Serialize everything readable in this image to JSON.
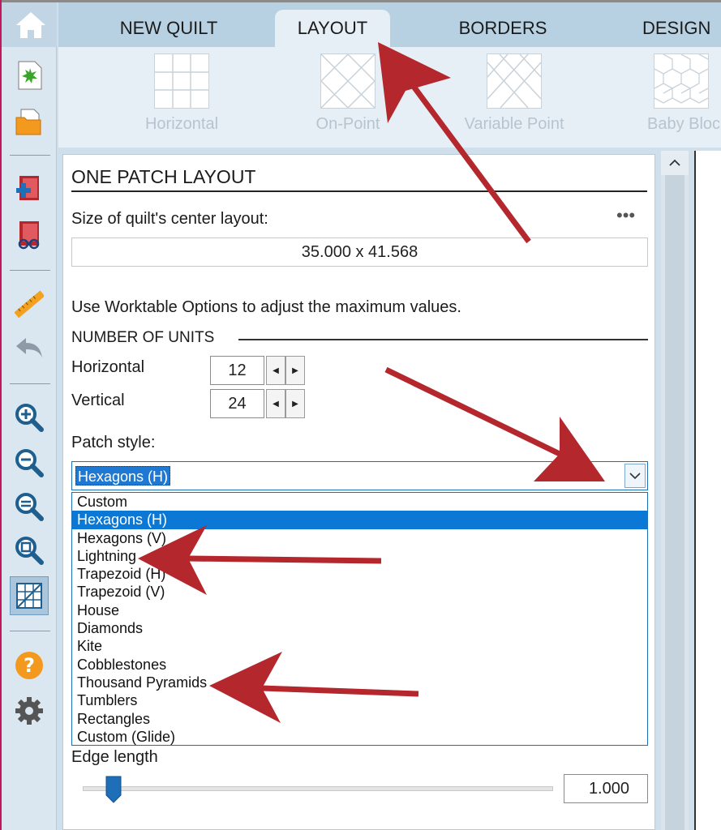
{
  "tabs": [
    {
      "label": "NEW QUILT",
      "active": false
    },
    {
      "label": "LAYOUT",
      "active": true
    },
    {
      "label": "BORDERS",
      "active": false
    },
    {
      "label": "DESIGN",
      "active": false
    }
  ],
  "left_toolbar": {
    "icons": [
      "home-icon",
      "new-quilt-icon",
      "open-folder-icon",
      "add-to-sketchbook-icon",
      "view-sketchbook-icon",
      "ruler-icon",
      "undo-icon",
      "zoom-in-icon",
      "zoom-out-icon",
      "zoom-fit-icon",
      "zoom-actual-icon",
      "grid-toggle-icon",
      "help-icon",
      "settings-icon"
    ]
  },
  "ribbon": {
    "buttons": [
      {
        "label": "Horizontal",
        "icon": "horizontal-layout-icon"
      },
      {
        "label": "On-Point",
        "icon": "on-point-layout-icon"
      },
      {
        "label": "Variable Point",
        "icon": "variable-point-layout-icon"
      },
      {
        "label": "Baby Blocks",
        "icon": "baby-blocks-layout-icon"
      }
    ]
  },
  "panel": {
    "title": "ONE PATCH LAYOUT",
    "size_label": "Size of quilt's center layout:",
    "more_label": "•••",
    "size_value": "35.000 x 41.568",
    "hint": "Use Worktable Options to adjust the maximum values.",
    "units_section": "NUMBER OF UNITS",
    "horizontal_label": "Horizontal",
    "horizontal_value": "12",
    "vertical_label": "Vertical",
    "vertical_value": "24",
    "patch_style_label": "Patch style:",
    "patch_style_selected": "Hexagons (H)",
    "patch_style_options": [
      "Custom",
      "Hexagons (H)",
      "Hexagons (V)",
      "Lightning",
      "Trapezoid (H)",
      "Trapezoid (V)",
      "House",
      "Diamonds",
      "Kite",
      "Cobblestones",
      "Thousand Pyramids",
      "Tumblers",
      "Rectangles",
      "Custom (Glide)"
    ],
    "edge_length_label": "Edge length",
    "edge_length_value": "1.000"
  },
  "colors": {
    "annotation_arrow": "#b3272d",
    "selection": "#0b78d6",
    "tab_bar": "#b8d1e2",
    "ribbon": "#e6eff6"
  }
}
